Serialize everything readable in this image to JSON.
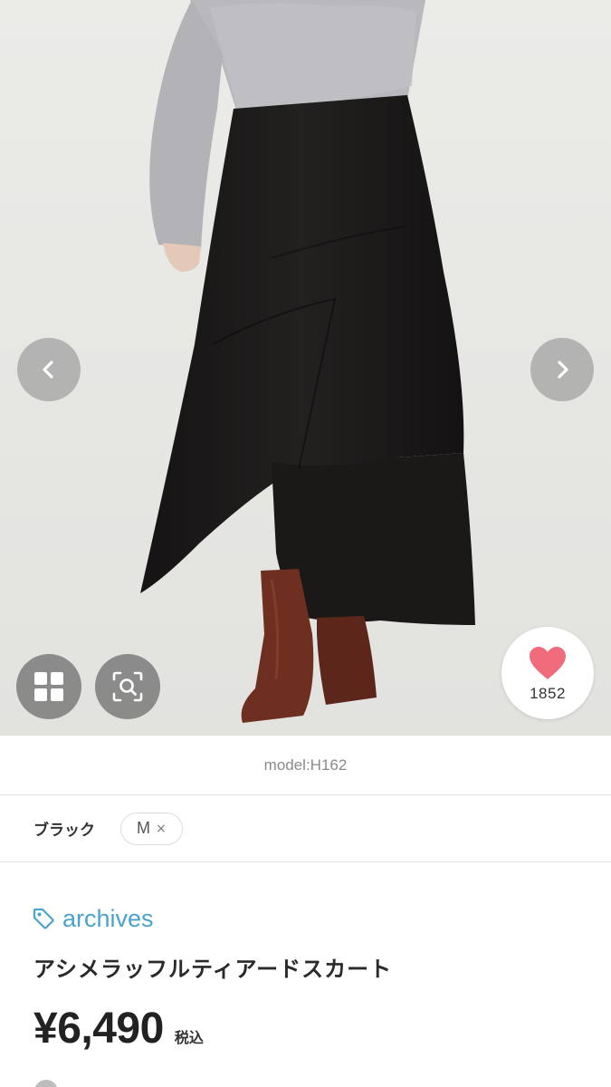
{
  "gallery": {
    "prev_icon": "chevron-left-icon",
    "next_icon": "chevron-right-icon",
    "grid_icon": "grid-icon",
    "zoom_icon": "image-search-icon",
    "like": {
      "icon": "heart-icon",
      "count": "1852",
      "color": "#f06b7b"
    }
  },
  "model": {
    "text": "model:H162"
  },
  "variant": {
    "color": "ブラック",
    "size": "M",
    "remove_symbol": "×"
  },
  "product": {
    "shop_icon": "tag-icon",
    "shop_name": "archives",
    "shop_color": "#4aa3cc",
    "title": "アシメラッフルティアードスカート",
    "price": "¥6,490",
    "tax_label": "税込"
  }
}
